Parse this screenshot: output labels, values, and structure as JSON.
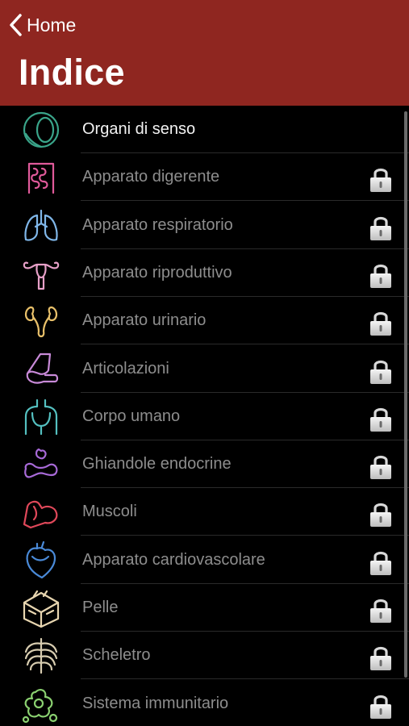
{
  "nav": {
    "back_label": "Home"
  },
  "header": {
    "title": "Indice"
  },
  "items": [
    {
      "label": "Organi di senso",
      "icon": "eye-icon",
      "color": "#3aa58a",
      "locked": false
    },
    {
      "label": "Apparato digerente",
      "icon": "intestine-icon",
      "color": "#e05a9a",
      "locked": true
    },
    {
      "label": "Apparato respiratorio",
      "icon": "lungs-icon",
      "color": "#7fb6e8",
      "locked": true
    },
    {
      "label": "Apparato riproduttivo",
      "icon": "uterus-icon",
      "color": "#e7a0c8",
      "locked": true
    },
    {
      "label": "Apparato urinario",
      "icon": "kidneys-icon",
      "color": "#e8c06a",
      "locked": true
    },
    {
      "label": "Articolazioni",
      "icon": "joint-icon",
      "color": "#c88ad8",
      "locked": true
    },
    {
      "label": "Corpo umano",
      "icon": "torso-icon",
      "color": "#54c0c0",
      "locked": true
    },
    {
      "label": "Ghiandole endocrine",
      "icon": "glands-icon",
      "color": "#a86ad8",
      "locked": true
    },
    {
      "label": "Muscoli",
      "icon": "muscle-arm-icon",
      "color": "#e0485a",
      "locked": true
    },
    {
      "label": "Apparato cardiovascolare",
      "icon": "heart-icon",
      "color": "#4a8ad8",
      "locked": true
    },
    {
      "label": "Pelle",
      "icon": "skin-icon",
      "color": "#e8d6b0",
      "locked": true
    },
    {
      "label": "Scheletro",
      "icon": "ribcage-icon",
      "color": "#d8cdb0",
      "locked": true
    },
    {
      "label": "Sistema immunitario",
      "icon": "immune-cells-icon",
      "color": "#8ad070",
      "locked": true
    }
  ]
}
